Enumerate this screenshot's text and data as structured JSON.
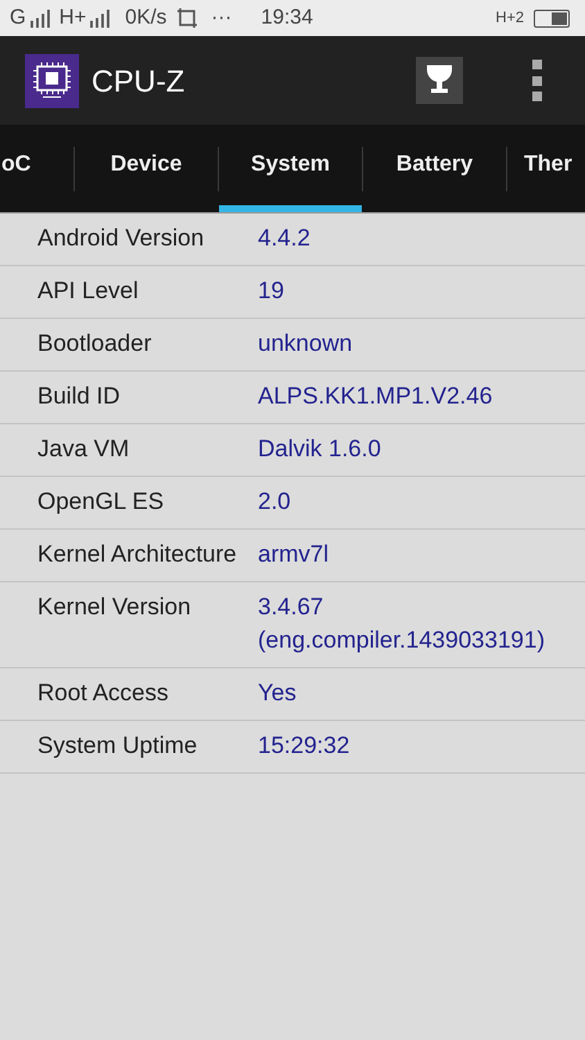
{
  "status_bar": {
    "network_1": "G",
    "network_2": "H+",
    "speed": "0K/s",
    "more": "···",
    "time": "19:34",
    "network_3": "H+2"
  },
  "app_bar": {
    "title": "CPU-Z"
  },
  "tabs": [
    {
      "label": "oC",
      "selected": false
    },
    {
      "label": "Device",
      "selected": false
    },
    {
      "label": "System",
      "selected": true
    },
    {
      "label": "Battery",
      "selected": false
    },
    {
      "label": "Ther",
      "selected": false
    }
  ],
  "rows": [
    {
      "label": "Android Version",
      "value": "4.4.2"
    },
    {
      "label": "API Level",
      "value": "19"
    },
    {
      "label": "Bootloader",
      "value": "unknown"
    },
    {
      "label": "Build ID",
      "value": "ALPS.KK1.MP1.V2.46"
    },
    {
      "label": "Java VM",
      "value": "Dalvik 1.6.0"
    },
    {
      "label": "OpenGL ES",
      "value": "2.0"
    },
    {
      "label": "Kernel Architecture",
      "value": "armv7l"
    },
    {
      "label": "Kernel Version",
      "value": "3.4.67\n(eng.compiler.1439033191)"
    },
    {
      "label": "Root Access",
      "value": "Yes"
    },
    {
      "label": "System Uptime",
      "value": "15:29:32"
    }
  ]
}
